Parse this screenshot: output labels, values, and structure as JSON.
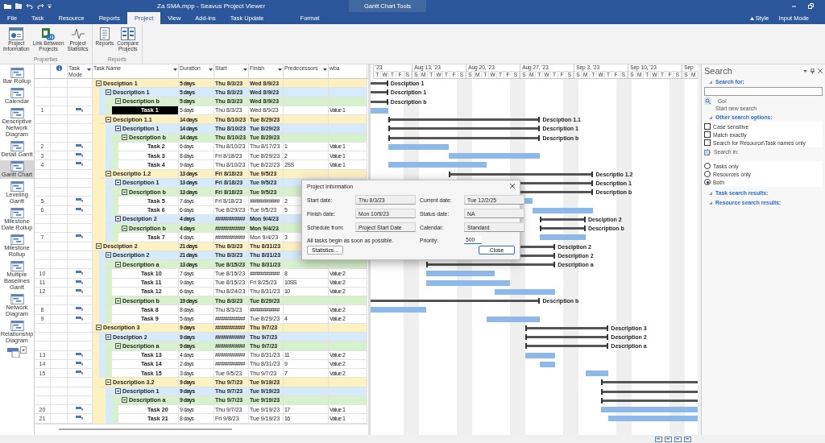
{
  "window": {
    "title": "Za SMA.mpp - Seavus Project Viewer",
    "context_group": "Gantt Chart Tools"
  },
  "ribbon_tabs": [
    {
      "label": "File",
      "selected": false
    },
    {
      "label": "Task",
      "selected": false
    },
    {
      "label": "Resource",
      "selected": false
    },
    {
      "label": "Reports",
      "selected": false
    },
    {
      "label": "Project",
      "selected": true
    },
    {
      "label": "View",
      "selected": false
    },
    {
      "label": "Add-ins",
      "selected": false
    },
    {
      "label": "Task Update",
      "selected": false
    },
    {
      "label": "Format",
      "selected": false,
      "kind": "context"
    }
  ],
  "ribbon_right": [
    "Style",
    "Input Mode"
  ],
  "ribbon_groups": [
    {
      "name": "Properties",
      "buttons": [
        {
          "label": "Project Information",
          "kind": "info"
        },
        {
          "label": "Link Between Projects",
          "kind": "link"
        },
        {
          "label": "Project Statistics",
          "kind": "stats"
        }
      ]
    },
    {
      "name": "Reports",
      "buttons": [
        {
          "label": "Reports",
          "kind": "report"
        },
        {
          "label": "Compare Projects",
          "kind": "compare"
        }
      ]
    }
  ],
  "view_bar": [
    {
      "label": "Bar Rollup",
      "selected": false
    },
    {
      "label": "Calendar",
      "selected": false
    },
    {
      "label": "Descriptive Network Diagram",
      "selected": false
    },
    {
      "label": "Detail Gantt",
      "selected": false
    },
    {
      "label": "Gantt Chart",
      "selected": true
    },
    {
      "label": "Leveling Gantt",
      "selected": false
    },
    {
      "label": "Milestone Date Rollup",
      "selected": false
    },
    {
      "label": "Milestone Rollup",
      "selected": false
    },
    {
      "label": "Multiple Baselines Gantt",
      "selected": false
    },
    {
      "label": "Network Diagram",
      "selected": false
    },
    {
      "label": "Relationship Diagram",
      "selected": false
    }
  ],
  "table": {
    "columns": [
      {
        "label": "Task Mode",
        "filter": true
      },
      {
        "label": "Task Name",
        "filter": true
      },
      {
        "label": "Duration",
        "filter": true
      },
      {
        "label": "Start",
        "filter": true
      },
      {
        "label": "Finish",
        "filter": true
      },
      {
        "label": "Predecessors",
        "filter": true
      },
      {
        "label": "wba",
        "filter": false
      }
    ],
    "rows": [
      {
        "kind": "summary",
        "name": "Desciption 1",
        "duration": "5 days",
        "start": "Thu 8/3/23",
        "finish": "Wed 8/9/23",
        "color": "#fdf1c2",
        "expanded": true,
        "selected": false,
        "children": [
          {
            "kind": "summary",
            "name": "Description 1",
            "duration": "5 days",
            "start": "Thu 8/3/23",
            "finish": "Wed 8/9/23",
            "color": "#d5eafa",
            "expanded": true,
            "selected": false,
            "children": [
              {
                "kind": "summary",
                "name": "Description b",
                "duration": "5 days",
                "start": "Thu 8/3/23",
                "finish": "Wed 8/9/23",
                "color": "#d8f1cd",
                "expanded": true,
                "selected": false,
                "children": [
                  {
                    "kind": "task",
                    "id": "1",
                    "name": "Task 1",
                    "duration": "5 days",
                    "start": "Thu 8/3/23",
                    "finish": "Wed 8/9/23",
                    "wba": "Value 1",
                    "selected": true
                  }
                ]
              }
            ]
          },
          {
            "kind": "summary",
            "name": "Desciption 1.1",
            "duration": "14 days",
            "start": "Thu 8/10/23",
            "finish": "Tue 8/29/23",
            "color": "#fdf1c2",
            "expanded": true,
            "selected": false,
            "children": [
              {
                "kind": "summary",
                "name": "Description 1",
                "duration": "14 days",
                "start": "Thu 8/10/23",
                "finish": "Tue 8/29/23",
                "color": "#d5eafa",
                "expanded": true,
                "selected": false,
                "children": [
                  {
                    "kind": "summary",
                    "name": "Description b",
                    "duration": "14 days",
                    "start": "Thu 8/10/23",
                    "finish": "Tue 8/29/23",
                    "color": "#d8f1cd",
                    "expanded": true,
                    "selected": false,
                    "children": [
                      {
                        "kind": "task",
                        "id": "2",
                        "name": "Task 2",
                        "duration": "6 days",
                        "start": "Thu 8/10/23",
                        "finish": "Thu 8/17/23",
                        "predecessors": "1",
                        "wba": "Value 1",
                        "selected": false
                      },
                      {
                        "kind": "task",
                        "id": "3",
                        "name": "Task 3",
                        "duration": "8 days",
                        "start": "Fri 8/18/23",
                        "finish": "Tue 8/29/23",
                        "predecessors": "2",
                        "wba": "Value 1",
                        "selected": false
                      },
                      {
                        "kind": "task",
                        "id": "4",
                        "name": "Task 4",
                        "duration": "9 days",
                        "start": "Thu 8/10/23",
                        "finish": "Tue 8/22/23",
                        "predecessors": "2SS",
                        "wba": "Value 1",
                        "selected": false
                      }
                    ]
                  }
                ]
              }
            ]
          },
          {
            "kind": "summary",
            "name": "Descriptio 1.2",
            "duration": "13 days",
            "start": "Fri 8/18/23",
            "finish": "Tue 9/5/23",
            "color": "#fdf1c2",
            "expanded": true,
            "selected": false,
            "children": [
              {
                "kind": "summary",
                "name": "Description 1",
                "duration": "13 days",
                "start": "Fri 8/18/23",
                "finish": "Tue 9/5/23",
                "color": "#d5eafa",
                "expanded": true,
                "selected": false,
                "children": [
                  {
                    "kind": "summary",
                    "name": "Description b",
                    "duration": "13 days",
                    "start": "Fri 8/18/23",
                    "finish": "Tue 9/5/23",
                    "color": "#d8f1cd",
                    "expanded": true,
                    "selected": false,
                    "children": [
                      {
                        "kind": "task",
                        "id": "5",
                        "name": "Task 5",
                        "duration": "7 days",
                        "start": "Fri 8/18/23",
                        "finish": "###########",
                        "predecessors": "2",
                        "selected": false
                      },
                      {
                        "kind": "task",
                        "id": "6",
                        "name": "Task 6",
                        "duration": "6 days",
                        "start": "Tue 8/29/23",
                        "finish": "Tue 9/5/23",
                        "predecessors": "5",
                        "selected": false
                      }
                    ]
                  }
                ]
              },
              {
                "kind": "summary",
                "name": "Desciption 2",
                "duration": "4 days",
                "start": "###########",
                "finish": "Mon 9/4/23",
                "color": "#d5eafa",
                "expanded": true,
                "selected": false,
                "children": [
                  {
                    "kind": "summary",
                    "name": "Description b",
                    "duration": "4 days",
                    "start": "###########",
                    "finish": "Mon 9/4/23",
                    "color": "#d8f1cd",
                    "expanded": true,
                    "selected": false,
                    "children": [
                      {
                        "kind": "task",
                        "id": "7",
                        "name": "Task 7",
                        "duration": "4 days",
                        "start": "###########",
                        "finish": "Mon 9/4/23",
                        "predecessors": "3",
                        "selected": false
                      }
                    ]
                  }
                ]
              }
            ]
          }
        ]
      },
      {
        "kind": "summary",
        "name": "Desciption 2",
        "duration": "21 days",
        "start": "Thu 8/3/23",
        "finish": "Thu 8/31/23",
        "color": "#fdf1c2",
        "expanded": true,
        "selected": false,
        "children": [
          {
            "kind": "summary",
            "name": "Description 2",
            "duration": "21 days",
            "start": "Thu 8/3/23",
            "finish": "Thu 8/31/23",
            "color": "#d5eafa",
            "expanded": true,
            "selected": false,
            "children": [
              {
                "kind": "summary",
                "name": "Description a",
                "duration": "13 days",
                "start": "Tue 8/15/23",
                "finish": "Thu 8/31/23",
                "color": "#d8f1cd",
                "expanded": true,
                "selected": false,
                "children": [
                  {
                    "kind": "task",
                    "id": "10",
                    "name": "Task 10",
                    "duration": "7 days",
                    "start": "Tue 8/15/23",
                    "finish": "###########",
                    "predecessors": "8",
                    "wba": "Value 2",
                    "selected": false
                  },
                  {
                    "kind": "task",
                    "id": "11",
                    "name": "Task 11",
                    "duration": "9 days",
                    "start": "Tue 8/15/23",
                    "finish": "Fri 8/25/23",
                    "predecessors": "10SS",
                    "wba": "Value 2",
                    "selected": false
                  },
                  {
                    "kind": "task",
                    "id": "12",
                    "name": "Task 12",
                    "duration": "6 days",
                    "start": "Thu 8/24/23",
                    "finish": "Thu 8/31/23",
                    "predecessors": "10",
                    "wba": "Value 2",
                    "selected": false
                  }
                ]
              },
              {
                "kind": "summary",
                "name": "Description b",
                "duration": "19 days",
                "start": "Thu 8/3/23",
                "finish": "Tue 8/29/23",
                "color": "#d8f1cd",
                "expanded": true,
                "selected": false,
                "children": [
                  {
                    "kind": "task",
                    "id": "8",
                    "name": "Task 8",
                    "duration": "8 days",
                    "start": "Thu 8/3/23",
                    "finish": "###########",
                    "wba": "Value 2",
                    "selected": false
                  },
                  {
                    "kind": "task",
                    "id": "9",
                    "name": "Task 9",
                    "duration": "5 days",
                    "start": "###########",
                    "finish": "Tue 8/29/23",
                    "predecessors": "4",
                    "wba": "Value 2",
                    "selected": false
                  }
                ]
              }
            ]
          }
        ]
      },
      {
        "kind": "summary",
        "name": "Description 3",
        "duration": "9 days",
        "start": "###########",
        "finish": "Thu 9/7/23",
        "color": "#fdf1c2",
        "expanded": true,
        "selected": false,
        "children": [
          {
            "kind": "summary",
            "name": "Desciption 2",
            "duration": "9 days",
            "start": "###########",
            "finish": "Thu 9/7/23",
            "color": "#d5eafa",
            "expanded": true,
            "selected": false,
            "children": [
              {
                "kind": "summary",
                "name": "Description a",
                "duration": "9 days",
                "start": "###########",
                "finish": "Thu 9/7/23",
                "color": "#d8f1cd",
                "expanded": true,
                "selected": false,
                "children": [
                  {
                    "kind": "task",
                    "id": "13",
                    "name": "Task 13",
                    "duration": "4 days",
                    "start": "###########",
                    "finish": "Thu 8/31/23",
                    "predecessors": "11",
                    "wba": "Value 2",
                    "selected": false
                  },
                  {
                    "kind": "task",
                    "id": "14",
                    "name": "Task 14",
                    "duration": "2 days",
                    "start": "###########",
                    "finish": "Thu 8/31/23",
                    "predecessors": "9",
                    "wba": "Value 2",
                    "selected": false
                  },
                  {
                    "kind": "task",
                    "id": "15",
                    "name": "Task 15",
                    "duration": "3 days",
                    "start": "Tue 9/5/23",
                    "finish": "Thu 9/7/23",
                    "predecessors": "7",
                    "wba": "Value 2",
                    "selected": false
                  }
                ]
              }
            ]
          },
          {
            "kind": "summary",
            "name": "Description 3.2",
            "duration": "9 days",
            "start": "Thu 9/7/23",
            "finish": "Tue 9/19/23",
            "color": "#fdf1c2",
            "expanded": true,
            "selected": false,
            "children": [
              {
                "kind": "summary",
                "name": "Description 1",
                "duration": "9 days",
                "start": "Thu 9/7/23",
                "finish": "Tue 9/19/23",
                "color": "#d5eafa",
                "expanded": true,
                "selected": false,
                "children": [
                  {
                    "kind": "summary",
                    "name": "Description a",
                    "duration": "9 days",
                    "start": "Thu 9/7/23",
                    "finish": "Tue 9/19/23",
                    "color": "#d8f1cd",
                    "expanded": true,
                    "selected": false,
                    "children": [
                      {
                        "kind": "task",
                        "id": "20",
                        "name": "Task 20",
                        "duration": "9 days",
                        "start": "Thu 9/7/23",
                        "finish": "Tue 9/19/23",
                        "predecessors": "17",
                        "wba": "Value 1",
                        "selected": false
                      },
                      {
                        "kind": "task",
                        "id": "21",
                        "name": "Task 21",
                        "duration": "8 days",
                        "start": "Fri 9/8/23",
                        "finish": "Tue 9/19/23",
                        "predecessors": "16",
                        "wba": "Value 1",
                        "selected": false
                      }
                    ]
                  }
                ]
              }
            ]
          }
        ]
      }
    ]
  },
  "gantt": {
    "bar_labels": [
      "Desciption 1",
      "Description 1",
      "Description b",
      "Desciption 1.1",
      "Description 1",
      "Description b",
      "Descriptio 1.2",
      "Description 1",
      "Description b",
      "Desciption 2",
      "Description b",
      "Desciption 2",
      "Description 2",
      "Description a",
      "Description b",
      "Description 3",
      "Description 2",
      "Description a"
    ]
  },
  "timescale": {
    "weeks": [
      {
        "label": "'23",
        "days": [
          "T",
          "W",
          "T",
          "F",
          "S"
        ]
      },
      {
        "label": "Aug 13, '23",
        "days": [
          "S",
          "M",
          "T",
          "W",
          "T",
          "F",
          "S"
        ]
      },
      {
        "label": "Aug 20, '23",
        "days": [
          "S",
          "M",
          "T",
          "W",
          "T",
          "F",
          "S"
        ]
      },
      {
        "label": "Aug 27, '23",
        "days": [
          "S",
          "M",
          "T",
          "W",
          "T",
          "F",
          "S"
        ]
      },
      {
        "label": "Sep 3, '23",
        "days": [
          "S",
          "M",
          "T",
          "W",
          "T",
          "F",
          "S"
        ]
      },
      {
        "label": "Sep 10, '23",
        "days": [
          "S",
          "M",
          "T",
          "W",
          "T",
          "F",
          "S"
        ]
      },
      {
        "label": "Sep",
        "days": [
          "S",
          "M"
        ]
      }
    ]
  },
  "dialog": {
    "title": "Project Information",
    "fields": [
      {
        "label": "Start date:",
        "value": "Thu 8/3/23"
      },
      {
        "label": "Current date:",
        "value": "Tue 12/2/25"
      },
      {
        "label": "Finish date:",
        "value": "Mon 10/9/23"
      },
      {
        "label": "Status date:",
        "value": "NA"
      },
      {
        "label": "Schedule from:",
        "value": "Project Start Date"
      },
      {
        "label": "Calendar:",
        "value": "Standard"
      }
    ],
    "note": "All tasks begin as soon as possible.",
    "priority_label": "Priority:",
    "priority": "500",
    "buttons": [
      "Statistics...",
      "Close"
    ]
  },
  "search": {
    "title": "Search",
    "search_for": "Search for:",
    "go": "Go!",
    "new_search": "Start new search",
    "other_options": "Other search options:",
    "options": [
      {
        "label": "Case sensitive",
        "checked": false
      },
      {
        "label": "Match exactly",
        "checked": false
      },
      {
        "label": "Search for Resource\\Task names only",
        "checked": false
      }
    ],
    "search_in": "Search in:",
    "scopes": [
      {
        "label": "Tasks only",
        "selected": false
      },
      {
        "label": "Resources only",
        "selected": false
      },
      {
        "label": "Both",
        "selected": true
      }
    ],
    "task_results": "Task search results:",
    "resource_results": "Resource search results:"
  }
}
